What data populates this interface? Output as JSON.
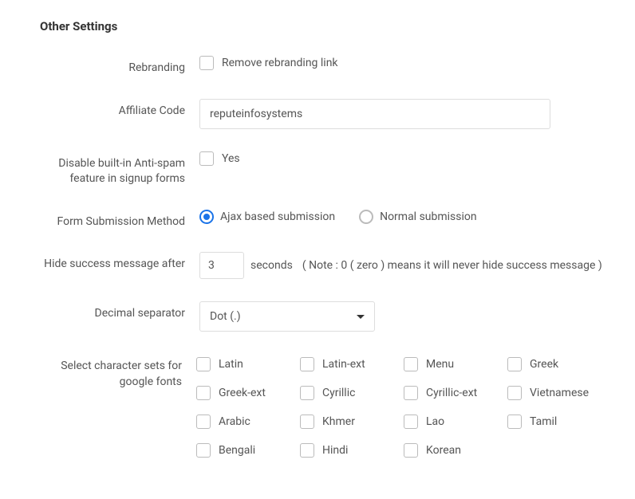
{
  "section_title": "Other Settings",
  "rebranding": {
    "label": "Rebranding",
    "checkbox_label": "Remove rebranding link"
  },
  "affiliate": {
    "label": "Affiliate Code",
    "value": "reputeinfosystems"
  },
  "antispam": {
    "label": "Disable built-in Anti-spam feature in signup forms",
    "checkbox_label": "Yes"
  },
  "submission": {
    "label": "Form Submission Method",
    "option_ajax": "Ajax based submission",
    "option_normal": "Normal submission"
  },
  "hide_success": {
    "label": "Hide success message after",
    "value": "3",
    "unit": "seconds",
    "note": "( Note : 0 ( zero ) means it will never hide success message )"
  },
  "decimal": {
    "label": "Decimal separator",
    "selected": "Dot (.)"
  },
  "charsets": {
    "label": "Select character sets for google fonts",
    "items": [
      "Latin",
      "Latin-ext",
      "Menu",
      "Greek",
      "Greek-ext",
      "Cyrillic",
      "Cyrillic-ext",
      "Vietnamese",
      "Arabic",
      "Khmer",
      "Lao",
      "Tamil",
      "Bengali",
      "Hindi",
      "Korean"
    ]
  }
}
